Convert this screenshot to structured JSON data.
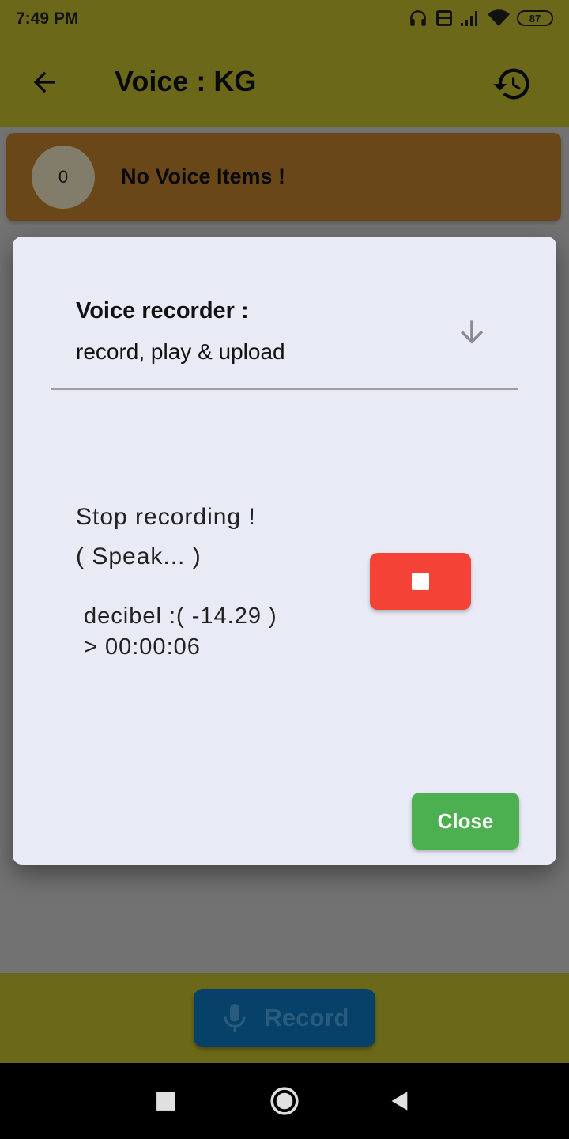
{
  "status_bar": {
    "time": "7:49 PM",
    "battery": "87",
    "icons": [
      "headphones-icon",
      "volte-icon",
      "signal-icon",
      "wifi-icon",
      "battery-icon"
    ]
  },
  "app_bar": {
    "title": "Voice : KG",
    "back_icon": "arrow-back-icon",
    "history_icon": "history-icon"
  },
  "voice_list": {
    "count": "0",
    "empty_text": "No Voice Items !"
  },
  "dialog": {
    "title": "Voice recorder :",
    "subtitle": "record, play & upload",
    "expand_icon": "arrow-down-icon",
    "status": "Stop recording !",
    "hint": "( Speak... )",
    "decibel": "decibel :( -14.29 )",
    "timer": "> 00:00:06",
    "stop_icon": "stop-icon",
    "close_label": "Close"
  },
  "bottom_bar": {
    "record_label": "Record",
    "record_icon": "mic-icon"
  },
  "nav_bar": {
    "icons": [
      "recents-icon",
      "home-icon",
      "back-icon"
    ]
  },
  "colors": {
    "app_bar": "#c8c130",
    "card": "#c4832e",
    "record_button": "#0b78c0",
    "stop_button": "#f44336",
    "close_button": "#4caf50",
    "dialog_bg": "#e8eaf6"
  }
}
